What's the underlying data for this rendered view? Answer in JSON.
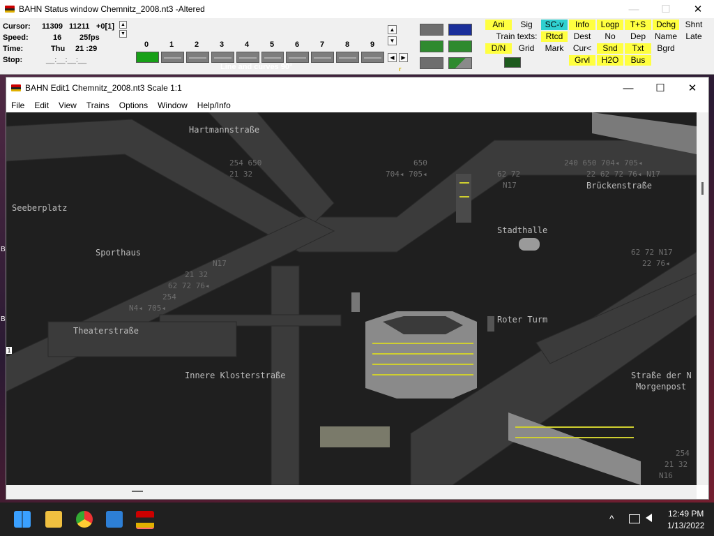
{
  "status_window": {
    "title": "BAHN Status window Chemnitz_2008.nt3 -Altered",
    "window_buttons": {
      "minimize": "—",
      "maximize": "☐",
      "close": "✕"
    },
    "readouts": {
      "cursor_label": "Cursor:",
      "cursor_x": "11309",
      "cursor_y": "11211",
      "cursor_extra": "+0[1]",
      "speed_label": "Speed:",
      "speed_value": "16",
      "speed_fps": "25fps",
      "time_label": "Time:",
      "time_day": "Thu",
      "time_value": "21 :29",
      "stop_label": "Stop:",
      "stop_value": "__:__:__:__"
    },
    "track_numbers": [
      "0",
      "1",
      "2",
      "3",
      "4",
      "5",
      "6",
      "7",
      "8",
      "9"
    ],
    "track_mode_label": "Line and curves 90°",
    "arrows": {
      "up": "▲",
      "down": "▼",
      "left": "◀",
      "right": "▶"
    },
    "r_marker": "r",
    "toggles": {
      "ani": "Ani",
      "sig": "Sig",
      "sc_v": "SC-v",
      "info": "Info",
      "logp": "Logp",
      "t_s": "T+S",
      "dchg": "Dchg",
      "shnt": "Shnt",
      "train_texts": "Train texts:",
      "rtcd": "Rtcd",
      "dest": "Dest",
      "no": "No",
      "dep": "Dep",
      "name": "Name",
      "late": "Late",
      "dn": "D/N",
      "grid": "Grid",
      "mark": "Mark",
      "cur": "Cur<",
      "snd": "Snd",
      "txt": "Txt",
      "bgrd": "Bgrd",
      "grvl": "Grvl",
      "h2o": "H2O",
      "bus": "Bus"
    }
  },
  "edit_window": {
    "title": "BAHN Edit1 Chemnitz_2008.nt3 Scale 1:1",
    "window_buttons": {
      "minimize": "—",
      "maximize": "☐",
      "close": "✕"
    },
    "menu": [
      "File",
      "Edit",
      "View",
      "Trains",
      "Options",
      "Window",
      "Help/Info"
    ],
    "map_labels": {
      "hartmann": "Hartmannstraße",
      "seeberplatz": "Seeberplatz",
      "sporthaus": "Sporthaus",
      "theater": "Theaterstraße",
      "innere": "Innere Klosterstraße",
      "stadthalle": "Stadthalle",
      "roter_turm": "Roter Turm",
      "bruecken": "Brückenstraße",
      "strasse_der": "Straße der N",
      "morgenpost": "Morgenpost"
    },
    "route_labels": {
      "r1": "254 650",
      "r2": "21 32",
      "r3": "650",
      "r4": "704◂ 705◂",
      "r5": "62 72",
      "r6": "N17",
      "r7": "240 650 704◂ 705◂",
      "r8": "22 62 72 76◂ N17",
      "r9": "N17",
      "r10": "21 32",
      "r11": "62 72 76◂",
      "r12": "254",
      "r13": "N4◂ 705◂",
      "r14": "62 72 N17",
      "r15": "22 76◂",
      "r16": "254",
      "r17": "21 32",
      "r18": "N16"
    },
    "cursor_marker": "1",
    "left_edge_marks": [
      "B",
      "B"
    ]
  },
  "taskbar": {
    "time": "12:49 PM",
    "date": "1/13/2022",
    "chevron": "^"
  }
}
